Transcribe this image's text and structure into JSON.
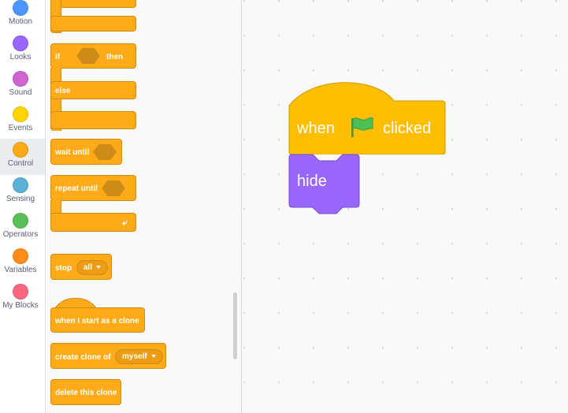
{
  "categories": [
    {
      "label": "Motion",
      "color": "#4c97ff"
    },
    {
      "label": "Looks",
      "color": "#9966ff"
    },
    {
      "label": "Sound",
      "color": "#cf63cf"
    },
    {
      "label": "Events",
      "color": "#ffd500"
    },
    {
      "label": "Control",
      "color": "#ffab19",
      "selected": true
    },
    {
      "label": "Sensing",
      "color": "#5cb1d6"
    },
    {
      "label": "Operators",
      "color": "#59c059"
    },
    {
      "label": "Variables",
      "color": "#ff8c1a"
    },
    {
      "label": "My Blocks",
      "color": "#ff6680"
    }
  ],
  "palette": {
    "if_label": "if",
    "then_label": "then",
    "else_label": "else",
    "wait_until_label": "wait until",
    "repeat_until_label": "repeat until",
    "stop_label": "stop",
    "stop_option": "all",
    "clone_start_label": "when I start as a clone",
    "create_clone_label": "create clone of",
    "create_clone_option": "myself",
    "delete_clone_label": "delete this clone"
  },
  "workspace": {
    "when_label": "when",
    "clicked_label": "clicked",
    "hide_label": "hide",
    "flag_icon": "green-flag-icon",
    "events_color": "#ffbf00",
    "looks_color": "#9966ff"
  }
}
